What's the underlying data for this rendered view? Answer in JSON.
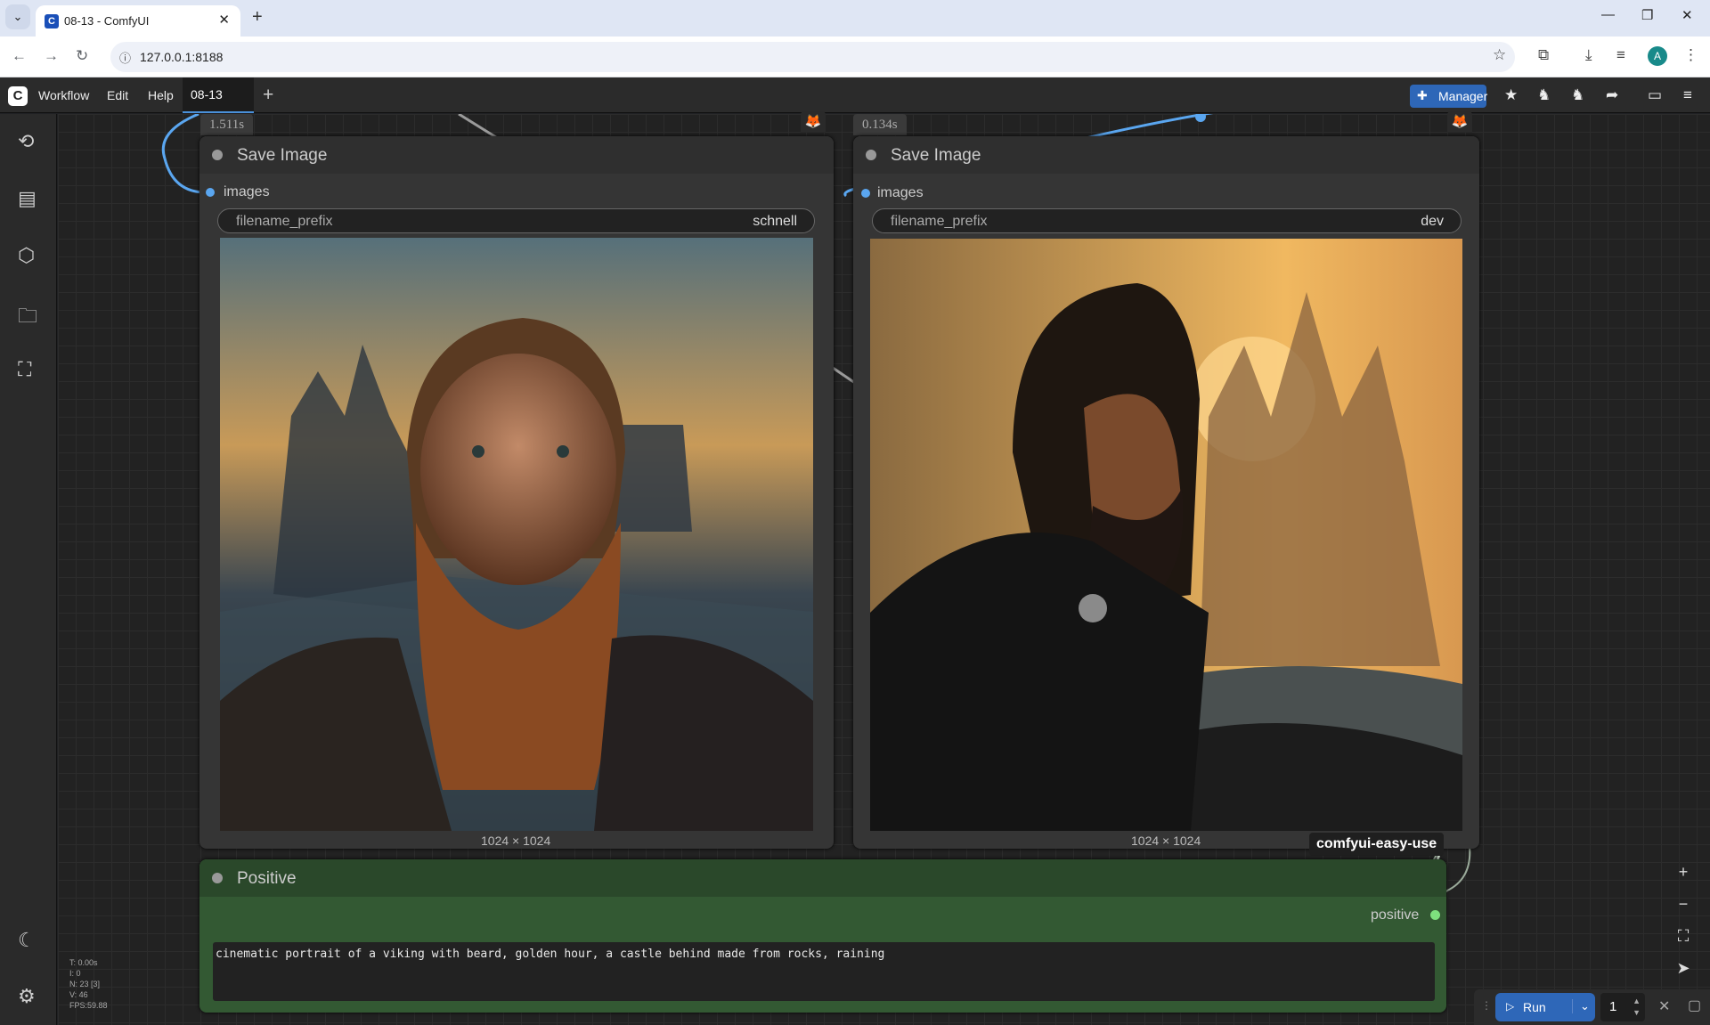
{
  "browser": {
    "tab_title": "08-13 - ComfyUI",
    "tab_favicon": "C",
    "url": "127.0.0.1:8188",
    "avatar_letter": "A"
  },
  "menu": {
    "items": [
      "Workflow",
      "Edit",
      "Help"
    ],
    "workflow_tab": "08-13",
    "manager_label": "Manager"
  },
  "nodes": {
    "save1": {
      "title": "Save Image",
      "exec_time": "1.511s",
      "input_label": "images",
      "widget_name": "filename_prefix",
      "widget_value": "schnell",
      "image_dims": "1024 × 1024"
    },
    "save2": {
      "title": "Save Image",
      "exec_time": "0.134s",
      "input_label": "images",
      "widget_name": "filename_prefix",
      "widget_value": "dev",
      "image_dims": "1024 × 1024"
    },
    "positive": {
      "title": "Positive",
      "output_label": "positive",
      "prompt": "cinematic portrait of a viking with beard, golden hour, a castle behind made from rocks, raining"
    }
  },
  "easy_use_tag": "comfyui-easy-use",
  "stats": [
    "T: 0.00s",
    "I: 0",
    "N: 23 [3]",
    "V: 46",
    "FPS:59.88"
  ],
  "run": {
    "label": "Run",
    "batch_count": "1"
  },
  "colors": {
    "accent": "#2e67b8",
    "link": "#5aa6f0",
    "positive_node": "#335933"
  }
}
